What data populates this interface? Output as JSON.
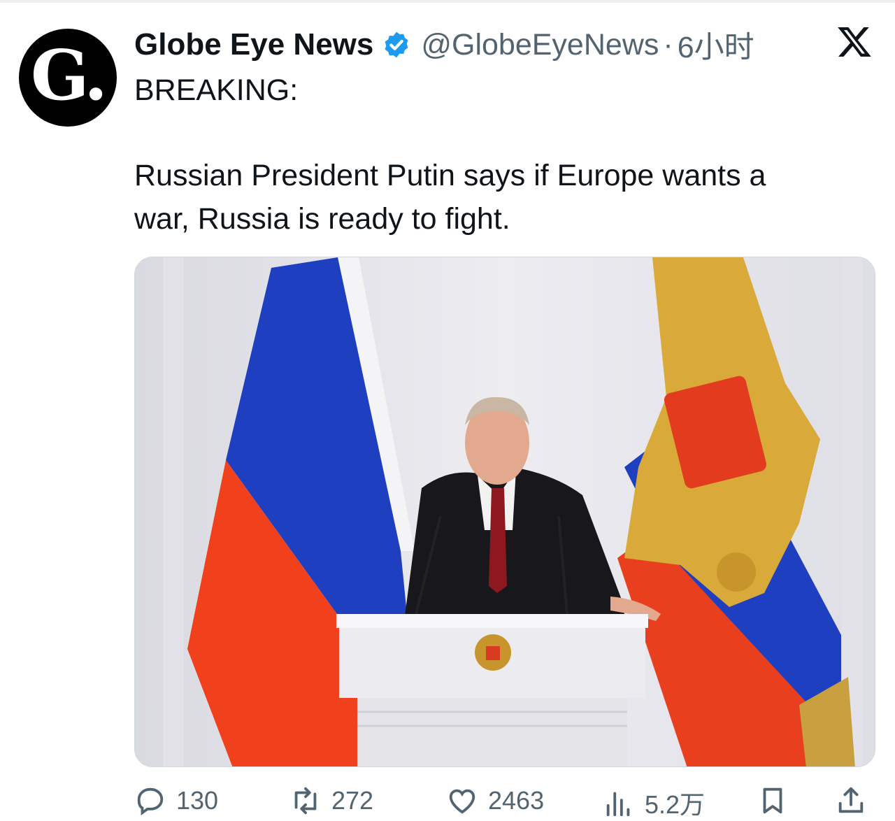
{
  "tweet": {
    "avatar_letter": "G.",
    "display_name": "Globe Eye News",
    "handle": "@GlobeEyeNews",
    "separator": "·",
    "time": "6小时",
    "text_lines": [
      "BREAKING:",
      "Russian President Putin says if Europe wants a",
      "war, Russia is ready to fight."
    ]
  },
  "actions": {
    "replies": "130",
    "reposts": "272",
    "likes": "2463",
    "views": "5.2万"
  },
  "colors": {
    "verified": "#1d9bf0",
    "muted_text": "#536471",
    "flag_white": "#f4f4f6",
    "flag_blue": "#1f3fc1",
    "flag_red": "#f1401c",
    "gold": "#d9a93a"
  },
  "icons": [
    "verified-badge-icon",
    "x-logo-icon",
    "reply-icon",
    "repost-icon",
    "like-icon",
    "views-icon",
    "bookmark-icon",
    "share-icon"
  ]
}
